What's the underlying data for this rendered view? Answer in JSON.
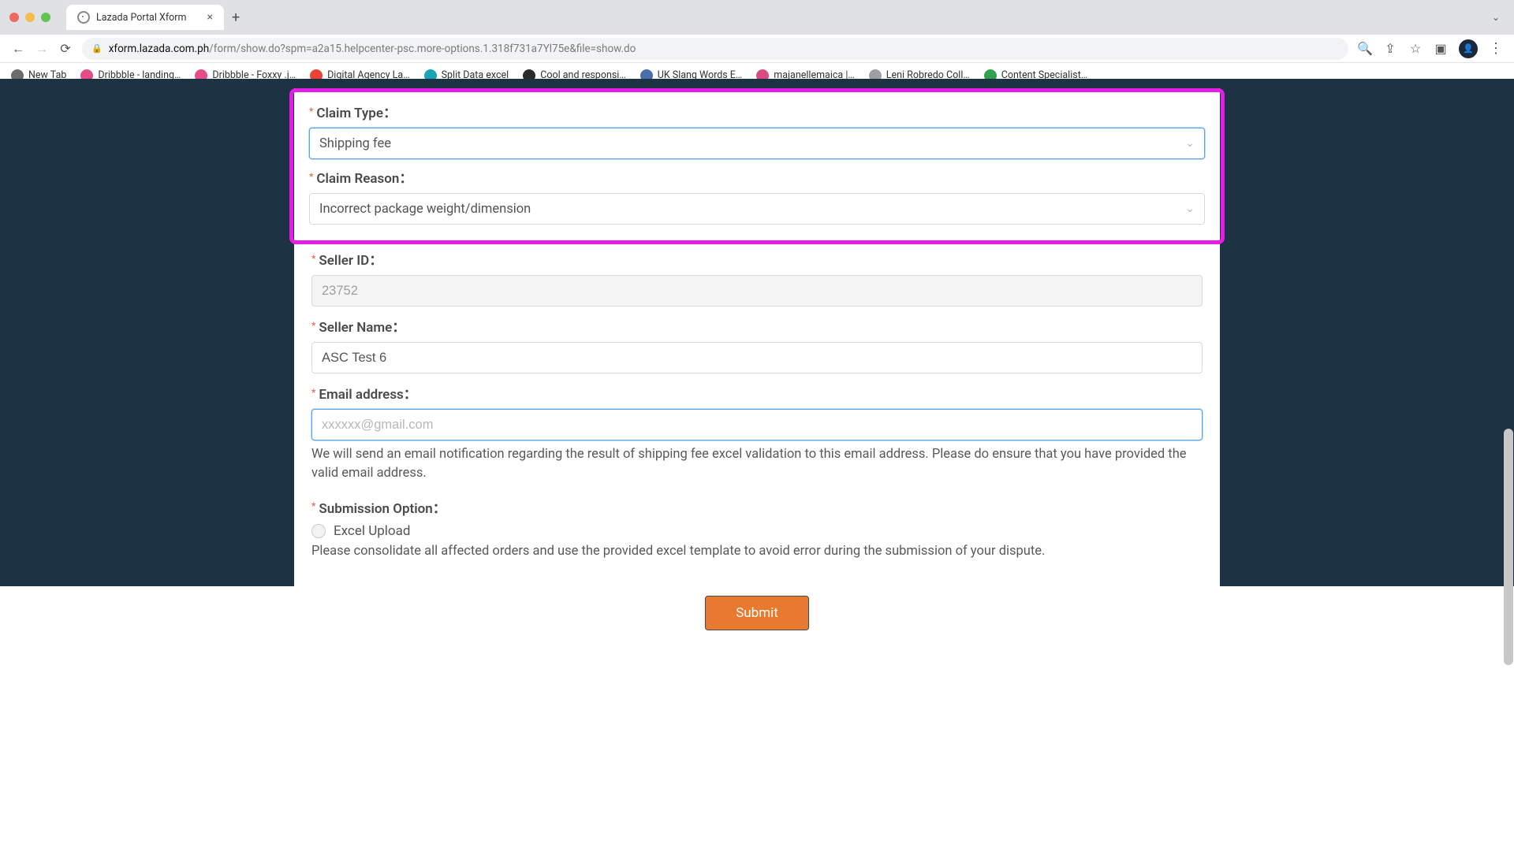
{
  "browser": {
    "tab_title": "Lazada Portal Xform",
    "url_domain": "xform.lazada.com.ph",
    "url_path": "/form/show.do?spm=a2a15.helpcenter-psc.more-options.1.318f731a7Yl75e&file=show.do"
  },
  "bookmarks": [
    {
      "label": "New Tab",
      "icon": "ico-globe"
    },
    {
      "label": "Dribbble - landing…",
      "icon": "ico-pink"
    },
    {
      "label": "Dribbble - Foxxy .j…",
      "icon": "ico-pink2"
    },
    {
      "label": "Digital Agency La…",
      "icon": "ico-g"
    },
    {
      "label": "Split Data excel",
      "icon": "ico-teal"
    },
    {
      "label": "Cool and responsi…",
      "icon": "ico-fd"
    },
    {
      "label": "UK Slang Words E…",
      "icon": "ico-uk"
    },
    {
      "label": "majanellemaica |…",
      "icon": "ico-mj"
    },
    {
      "label": "Leni Robredo Coll…",
      "icon": "ico-grey"
    },
    {
      "label": "Content Specialist…",
      "icon": "ico-green"
    }
  ],
  "form": {
    "claim_type": {
      "label": "Claim Type：",
      "value": "Shipping fee"
    },
    "claim_reason": {
      "label": "Claim Reason：",
      "value": "Incorrect package weight/dimension"
    },
    "seller_id": {
      "label": "Seller ID：",
      "value": "23752"
    },
    "seller_name": {
      "label": "Seller Name：",
      "value": "ASC Test 6"
    },
    "email": {
      "label": "Email address：",
      "placeholder": "xxxxxx@gmail.com",
      "help": "We will send an email notification regarding the result of shipping fee excel validation to this email address. Please do ensure that you have provided the valid email address."
    },
    "submission": {
      "label": "Submission Option：",
      "option": "Excel Upload",
      "help": "Please consolidate all affected orders and use the provided excel template to avoid error during the submission of your dispute."
    },
    "submit_label": "Submit"
  }
}
